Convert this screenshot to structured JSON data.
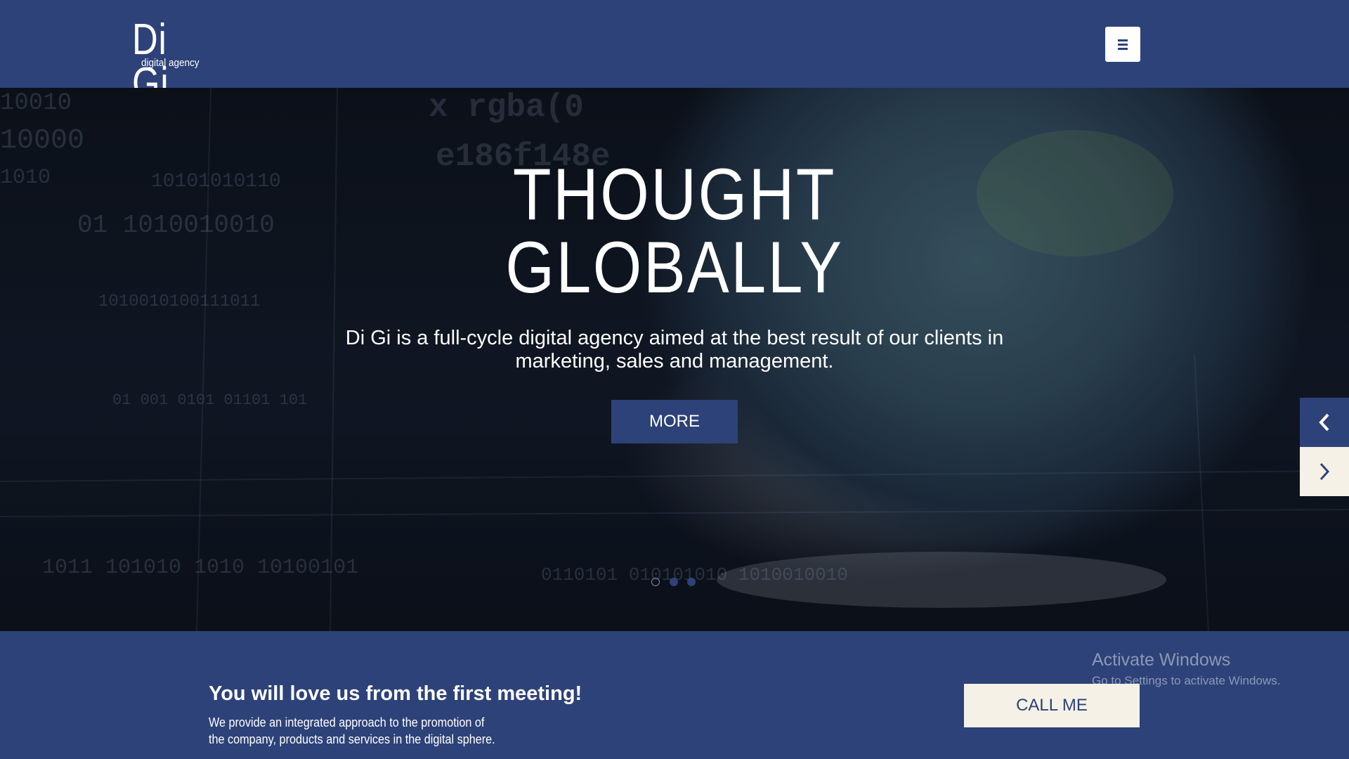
{
  "brand": {
    "logo_main": "Di Gi",
    "logo_sub": "digital agency",
    "colors": {
      "primary": "#2d4278",
      "light": "#f5f1e6",
      "text": "#ffffff"
    }
  },
  "header": {
    "menu_icon": "hamburger-icon"
  },
  "hero": {
    "title_line1": "THOUGHT",
    "title_line2": "GLOBALLY",
    "subtitle_line1": "Di Gi is a full-cycle digital agency aimed at the best result of our clients in",
    "subtitle_line2": "marketing, sales and management.",
    "more_label": "MORE",
    "slides": {
      "count": 3,
      "active_index": 0
    },
    "prev_icon": "chevron-left-icon",
    "next_icon": "chevron-right-icon"
  },
  "cta": {
    "title": "You will love us from the first meeting!",
    "text_line1": "We provide an integrated approach to the promotion of",
    "text_line2": "the company, products and services in the digital sphere.",
    "call_label": "CALL ME"
  },
  "watermark": {
    "title": "Activate Windows",
    "subtitle": "Go to Settings to activate Windows."
  }
}
